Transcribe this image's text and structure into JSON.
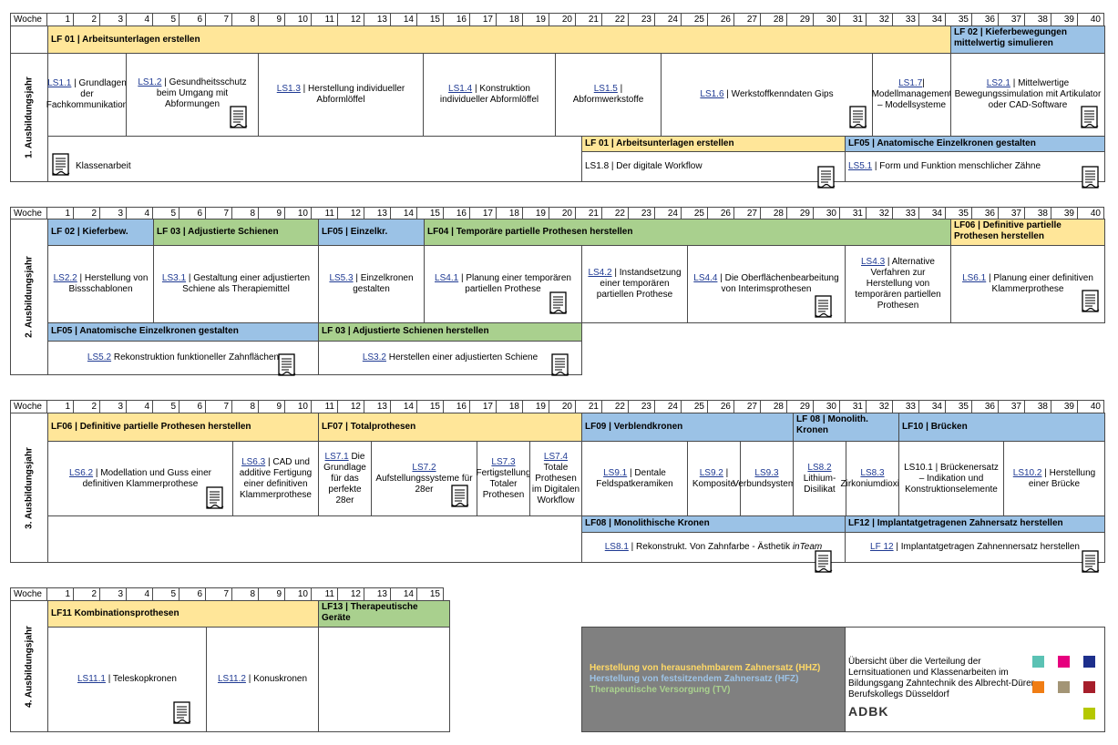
{
  "week_label": "Woche",
  "years": [
    "1. Ausbildungsjahr",
    "2. Ausbildungsjahr",
    "3. Ausbildungsjahr",
    "4. Ausbildungsjahr"
  ],
  "y1": {
    "h_lf01": "LF 01 | Arbeitsunterlagen erstellen",
    "h_lf02": "LF 02 | Kieferbewegungen mittelwertig simulieren",
    "c1_link": "LS1.1",
    "c1_text": " | Grundlagen der Fachkommunikation",
    "c2_link": "LS1.2",
    "c2_text": " | Gesundheitsschutz beim Umgang mit Abformungen",
    "c3_link": "LS1.3",
    "c3_text": " | Herstellung individueller Abformlöffel",
    "c4_link": "LS1.4",
    "c4_text": " | Konstruktion individueller Abformlöffel",
    "c5_link": "LS1.5",
    "c5_text": " | Abformwerkstoffe",
    "c6_link": "LS1.6",
    "c6_text": " | Werkstoffkenndaten Gips",
    "c7_link": "LS1.7",
    "c7_text": "| Modellmanagement – Modellsysteme",
    "c8_link": "LS2.1",
    "c8_text": " | Mittelwertige Bewegungssimulation mit Artikulator oder CAD-Software",
    "klassenarbeit": "Klassenarbeit",
    "h_lf01b": "LF 01 | Arbeitsunterlagen erstellen",
    "h_lf05": "LF05 | Anatomische Einzelkronen gestalten",
    "c9_text": "LS1.8 | Der digitale Workflow",
    "c10_link": "LS5.1",
    "c10_text": " | Form und Funktion menschlicher Zähne"
  },
  "y2": {
    "h1": "LF 02 | Kieferbew.",
    "h2": "LF 03 | Adjustierte Schienen",
    "h3": "LF05 | Einzelkr.",
    "h4": "LF04 | Temporäre partielle Prothesen herstellen",
    "h5": "LF06 | Definitive partielle Prothesen herstellen",
    "c1_link": "LS2.2",
    "c1_text": " | Herstellung von Bissschablonen",
    "c2_link": "LS3.1",
    "c2_text": " | Gestaltung einer adjustierten Schiene als Therapiemittel",
    "c3_link": "LS5.3",
    "c3_text": " | Einzelkronen gestalten",
    "c4_link": "LS4.1",
    "c4_text": " | Planung einer temporären partiellen Prothese",
    "c5_link": "LS4.2",
    "c5_text": " | Instandsetzung einer temporären partiellen Prothese",
    "c6_link": "LS4.4",
    "c6_text": " | Die Oberflächenbearbeitung von Interimsprothesen",
    "c7_link": "LS4.3",
    "c7_text": " | Alternative Verfahren zur Herstellung von temporären partiellen Prothesen",
    "c8_link": "LS6.1",
    "c8_text": " | Planung einer definitiven Klammerprothese",
    "h6": "LF05 | Anatomische Einzelkronen gestalten",
    "h7": "LF 03 | Adjustierte Schienen herstellen",
    "c9_link": "LS5.2",
    "c9_text": " Rekonstruktion funktioneller Zahnflächen",
    "c10_link": "LS3.2",
    "c10_text": " Herstellen einer adjustierten Schiene"
  },
  "y3": {
    "h1": "LF06 | Definitive partielle Prothesen herstellen",
    "h2": "LF07 | Totalprothesen",
    "h3": "LF09 | Verblendkronen",
    "h4": "LF 08 | Monolith. Kronen",
    "h5": "LF10 | Brücken",
    "c1_link": "LS6.2",
    "c1_text": " | Modellation und Guss einer definitiven Klammerprothese",
    "c2_link": "LS6.3",
    "c2_text": " | CAD und additive Fertigung einer definitiven Klammerprothese",
    "c3_link": "LS7.1",
    "c3_text": " Die Grundlage für das perfekte 28er",
    "c4_link": "LS7.2",
    "c4_text": "Aufstellungssysteme für 28er",
    "c5_link": "LS7.3",
    "c5_text": "Fertigstellung Totaler Prothesen",
    "c6_link": "LS7.4",
    "c6_text": "Totale Prothesen im Digitalen Workflow",
    "c7_link": "LS9.1",
    "c7_text": " | Dentale Feldspatkeramiken",
    "c8_link": "LS9.2",
    "c8_text": " | Komposite",
    "c9_link": "LS9.3",
    "c9_text": "Verbundsysteme",
    "c10_link": "LS8.2",
    "c10_text": " Lithium-Disilikat",
    "c11_link": "LS8.3",
    "c11_text": " Zirkoniumdioxid",
    "c12_text": "LS10.1 | Brückenersatz – Indikation und Konstruktionselemente",
    "c13_link": "LS10.2",
    "c13_text": " | Herstellung einer Brücke",
    "h6": "LF08 |  Monolithische Kronen",
    "h7": "LF12 |  Implantatgetragenen Zahnersatz herstellen",
    "c14_link": "LS8.1",
    "c14_text": " | Rekonstrukt. Von Zahnfarbe - Ästhetik ",
    "c14_em": "inTeam",
    "c15_link": "LF 12",
    "c15_text": " | Implantatgetragen Zahnennersatz herstellen"
  },
  "y4": {
    "h1": "LF11 Kombinationsprothesen",
    "h2": "LF13 | Therapeutische Geräte",
    "c1_link": "LS11.1",
    "c1_text": " | Teleskopkronen",
    "c2_link": "LS11.2",
    "c2_text": " | Konuskronen"
  },
  "legend": {
    "hhz": "Herstellung von herausnehmbarem Zahnersatz (HHZ)",
    "hfz": "Herstellung von festsitzendem Zahnersatz (HFZ)",
    "tv": "Therapeutische Versorgung (TV)",
    "info": "Übersicht über die Verteilung der Lernsituationen und Klassenarbeiten im Bildungsgang Zahntechnik des Albrecht-Dürer-Berufskollegs Düsseldorf",
    "logo": "ADBK"
  },
  "colors": {
    "yellow": "#ffe699",
    "blue": "#9bc2e6",
    "green": "#a9d08e",
    "hhz_text": "#ffd966",
    "hfz_text": "#9dc3e6",
    "tv_text": "#a9d08e"
  }
}
